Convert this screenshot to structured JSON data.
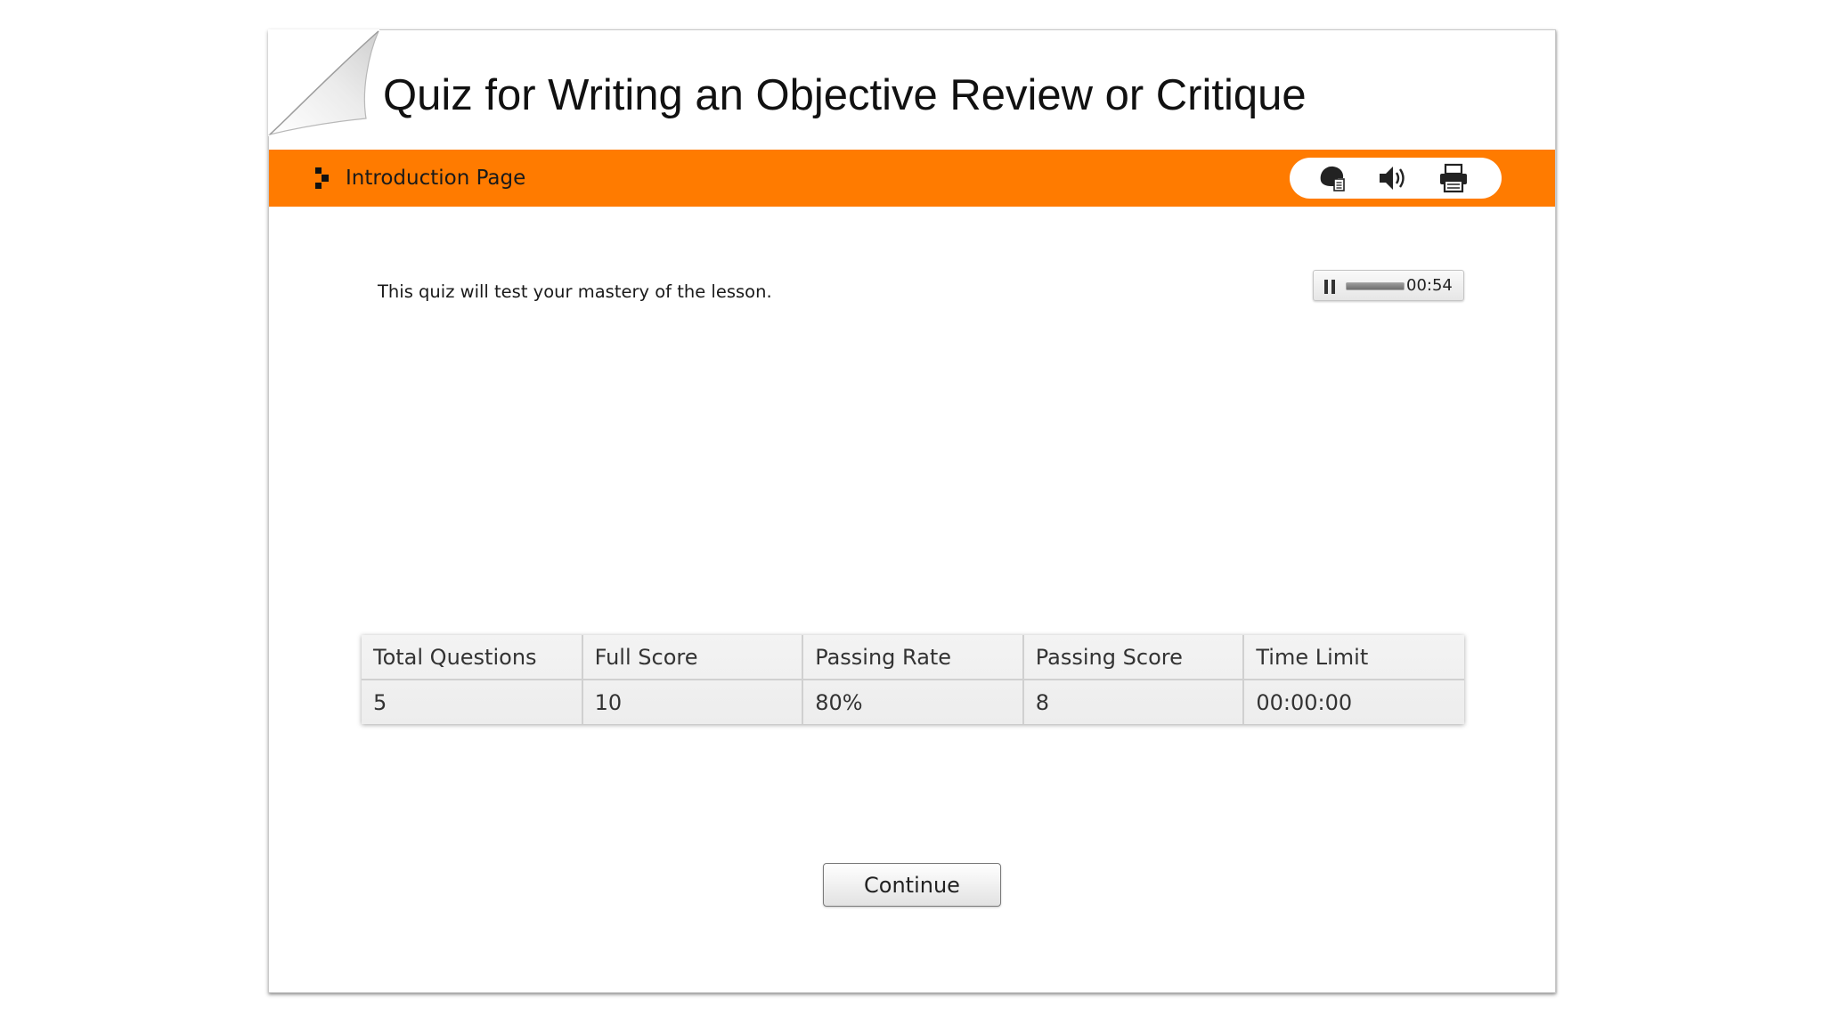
{
  "quiz": {
    "title": "Quiz for Writing an Objective Review or Critique"
  },
  "header_bar": {
    "page_label": "Introduction Page",
    "color": "#ff7b00",
    "tool_icons": [
      "help-icon",
      "audio-icon",
      "print-icon"
    ]
  },
  "content": {
    "intro_text": "This quiz will test your mastery of the lesson."
  },
  "audio_player": {
    "state": "playing",
    "time": "00:54",
    "progress": 1.0
  },
  "stats_table": {
    "headers": [
      "Total Questions",
      "Full Score",
      "Passing Rate",
      "Passing Score",
      "Time Limit"
    ],
    "values": [
      "5",
      "10",
      "80%",
      "8",
      "00:00:00"
    ]
  },
  "actions": {
    "continue_label": "Continue"
  }
}
